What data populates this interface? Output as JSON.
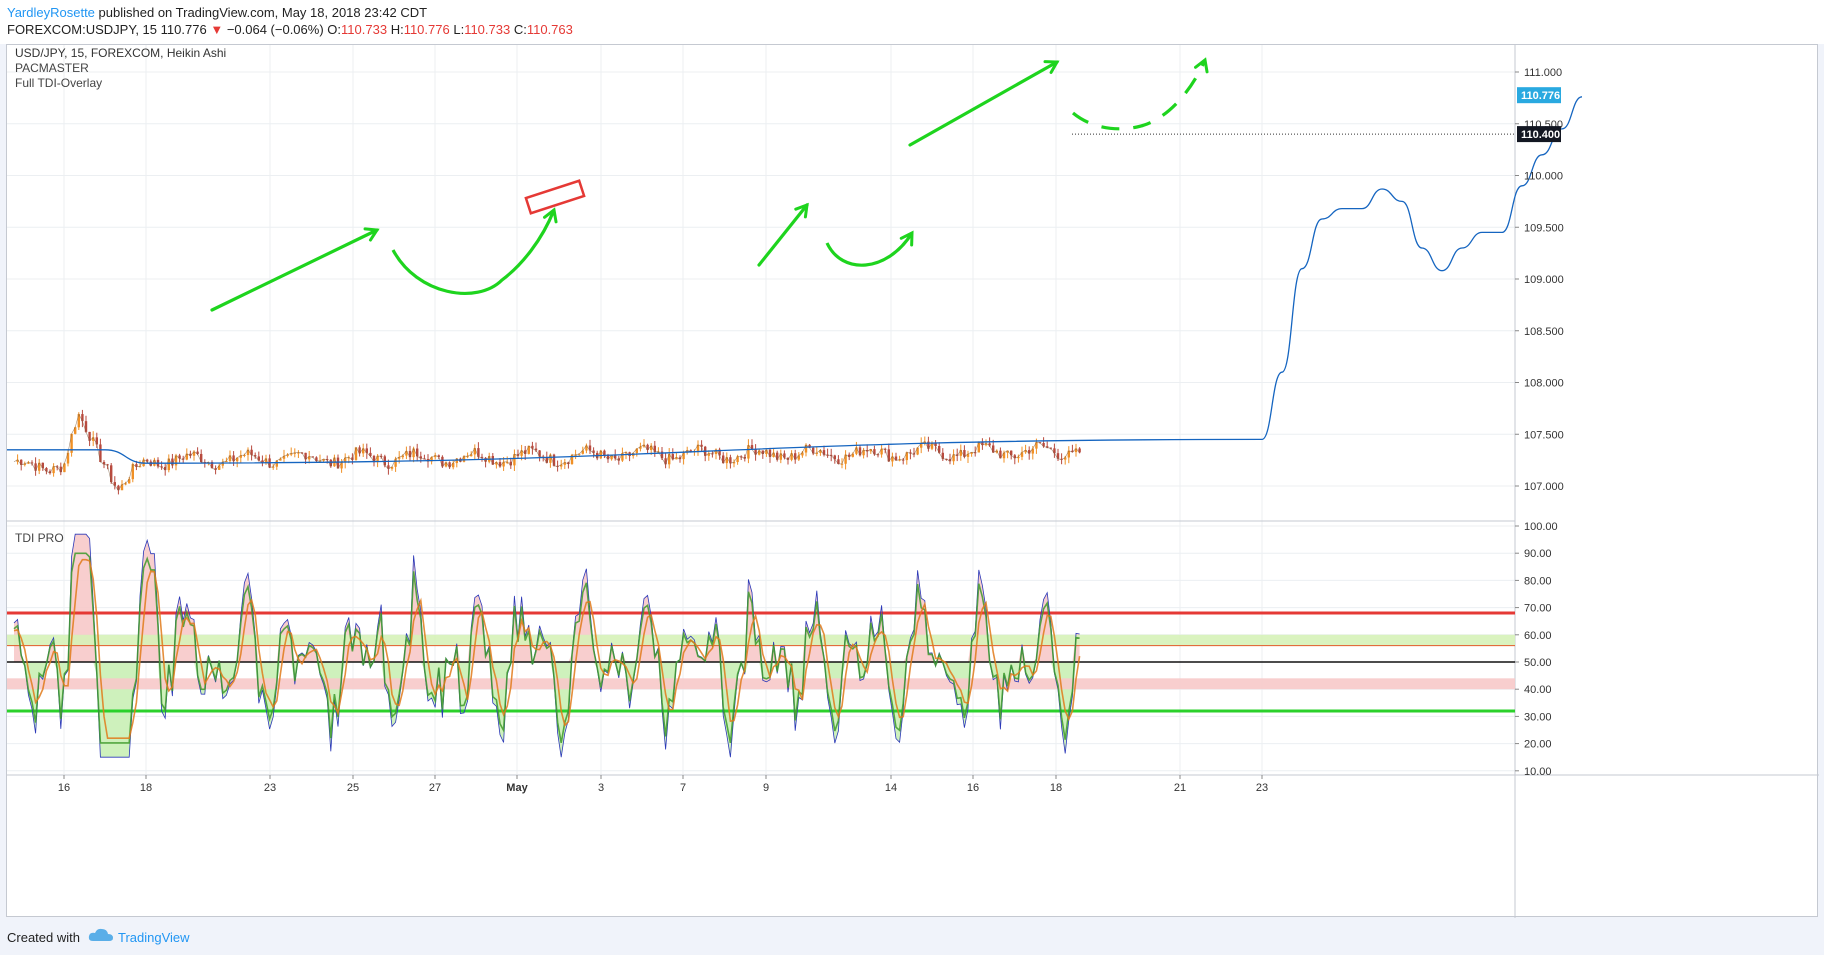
{
  "header": {
    "author": "YardleyRosette",
    "published": "published on TradingView.com, May 18, 2018 23:42 CDT",
    "symbol": "FOREXCOM:USDJPY, 15",
    "last": "110.776",
    "down_arrow": "▼",
    "change": "−0.064 (−0.06%)",
    "o_label": "O:",
    "o_value": "110.733",
    "h_label": "H:",
    "h_value": "110.776",
    "l_label": "L:",
    "l_value": "110.733",
    "c_label": "C:",
    "c_value": "110.763"
  },
  "legend": {
    "title": "USD/JPY, 15, FOREXCOM, Heikin Ashi",
    "ind1": "PACMASTER",
    "ind2": "Full TDI-Overlay",
    "tdi": "TDI PRO"
  },
  "footer": {
    "created": "Created with",
    "brand": "TradingView",
    "brand_icon": "tradingview-cloud-icon"
  },
  "colors": {
    "up": "#f09025",
    "down": "#b84a3e",
    "ma": "#1565c0",
    "annot": "#1ed41e",
    "box": "#e53935",
    "rsi": "#2b38b8",
    "fill_up": "#f7c9c9",
    "fill_dn": "#c9efb5",
    "band": "#e35a2a",
    "upper_line": "#e53935",
    "lower_line": "#2bd12b",
    "price_badge": "#29a9e0"
  },
  "chart_data": [
    {
      "type": "candlestick",
      "title": "USD/JPY, 15, FOREXCOM, Heikin Ashi",
      "x_ticks": [
        "16",
        "18",
        "23",
        "25",
        "27",
        "May",
        "3",
        "7",
        "9",
        "14",
        "16",
        "18",
        "21",
        "23"
      ],
      "y_ticks": [
        "111.000",
        "110.500",
        "110.000",
        "109.500",
        "109.000",
        "108.500",
        "108.000",
        "107.500",
        "107.000"
      ],
      "ylim": [
        106.62,
        111.36
      ],
      "current_price_label": "110.776",
      "horizontal_line_label": "110.400",
      "horizontal_line_value": 110.4,
      "price_path_keypoints": [
        [
          "16",
          107.2
        ],
        [
          "16",
          107.65
        ],
        [
          "17",
          107.25
        ],
        [
          "17",
          106.95
        ],
        [
          "18",
          107.25
        ],
        [
          "21",
          107.35
        ],
        [
          "22",
          107.6
        ],
        [
          "23",
          107.85
        ],
        [
          "24",
          108.75
        ],
        [
          "24",
          109.1
        ],
        [
          "25",
          109.25
        ],
        [
          "26",
          109.35
        ],
        [
          "27",
          109.15
        ],
        [
          "30",
          109.4
        ],
        [
          "May",
          109.7
        ],
        [
          "2",
          109.85
        ],
        [
          "3",
          109.3
        ],
        [
          "3",
          109.05
        ],
        [
          "7",
          109.0
        ],
        [
          "8",
          108.9
        ],
        [
          "9",
          109.8
        ],
        [
          "10",
          109.95
        ],
        [
          "11",
          109.4
        ],
        [
          "14",
          109.25
        ],
        [
          "15",
          109.9
        ],
        [
          "15",
          110.4
        ],
        [
          "16",
          110.2
        ],
        [
          "17",
          110.4
        ],
        [
          "17",
          110.75
        ],
        [
          "18",
          110.95
        ],
        [
          "18",
          110.776
        ]
      ],
      "moving_average": [
        [
          "16",
          107.35
        ],
        [
          "17",
          107.35
        ],
        [
          "18",
          107.22
        ],
        [
          "23",
          107.45
        ],
        [
          "24",
          108.1
        ],
        [
          "25",
          109.1
        ],
        [
          "26",
          109.58
        ],
        [
          "27",
          109.68
        ],
        [
          "May",
          109.68
        ],
        [
          "2",
          109.87
        ],
        [
          "3",
          109.75
        ],
        [
          "7",
          109.3
        ],
        [
          "9",
          109.08
        ],
        [
          "10",
          109.3
        ],
        [
          "11",
          109.45
        ],
        [
          "14",
          109.45
        ],
        [
          "15",
          109.9
        ],
        [
          "16",
          110.2
        ],
        [
          "17",
          110.45
        ],
        [
          "18",
          110.76
        ]
      ]
    },
    {
      "type": "line",
      "title": "TDI PRO",
      "x_ticks": [
        "16",
        "18",
        "23",
        "25",
        "27",
        "May",
        "3",
        "7",
        "9",
        "14",
        "16",
        "18",
        "21",
        "23"
      ],
      "y_ticks": [
        "100.00",
        "90.00",
        "80.00",
        "70.00",
        "60.00",
        "50.00",
        "40.00",
        "30.00",
        "20.00",
        "10.00"
      ],
      "ylim": [
        10,
        100
      ],
      "levels": {
        "upper": 68,
        "middle": 50,
        "lower": 32
      },
      "bands": [
        {
          "from": 56,
          "to": 60,
          "name": "upper zone"
        },
        {
          "from": 40,
          "to": 44,
          "name": "lower zone"
        }
      ]
    }
  ]
}
